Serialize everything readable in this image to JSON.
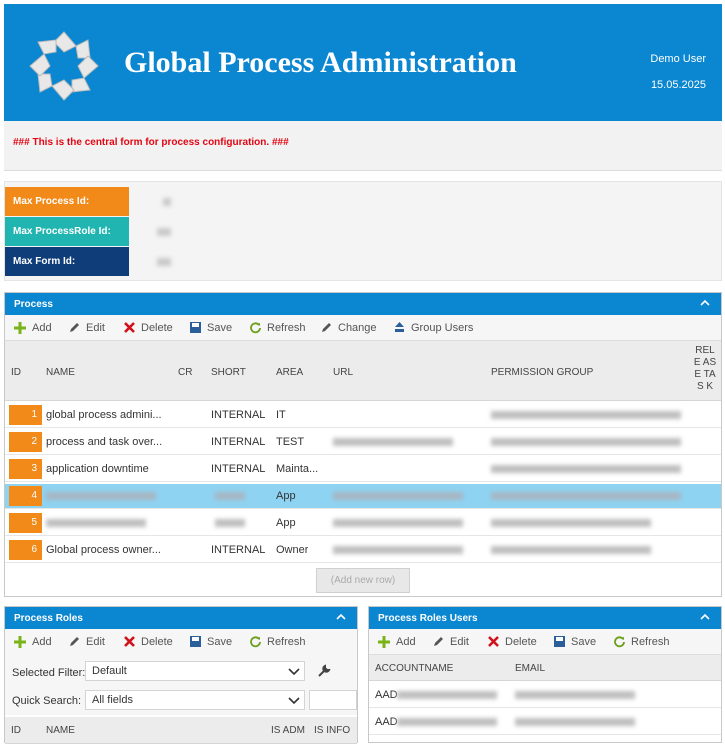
{
  "header": {
    "title": "Global Process Administration",
    "user": "Demo User",
    "date": "15.05.2025"
  },
  "banner": {
    "text": "### This is the central form for process configuration. ###"
  },
  "info": {
    "rows": [
      {
        "label": "Max Process Id:",
        "color": "#f28a1a"
      },
      {
        "label": "Max ProcessRole Id:",
        "color": "#20b5b0"
      },
      {
        "label": "Max Form Id:",
        "color": "#0f3d79"
      }
    ]
  },
  "process": {
    "title": "Process",
    "toolbar": [
      "Add",
      "Edit",
      "Delete",
      "Save",
      "Refresh",
      "Change",
      "Group Users"
    ],
    "columns": {
      "id": "ID",
      "name": "NAME",
      "cr": "CR",
      "short": "SHORT",
      "area": "AREA",
      "url": "URL",
      "perm": "PERMISSION GROUP",
      "release": "RELE ASE TAS K"
    },
    "rows": [
      {
        "id": "1",
        "name": "global process admini...",
        "short": "INTERNAL",
        "area": "IT"
      },
      {
        "id": "2",
        "name": "process and task over...",
        "short": "INTERNAL",
        "area": "TEST"
      },
      {
        "id": "3",
        "name": "application downtime",
        "short": "INTERNAL",
        "area": "Mainta..."
      },
      {
        "id": "4",
        "name": "",
        "short": "",
        "area": "App"
      },
      {
        "id": "5",
        "name": "",
        "short": "",
        "area": "App"
      },
      {
        "id": "6",
        "name": "Global process owner...",
        "short": "INTERNAL",
        "area": "Owner"
      }
    ],
    "add_row": "(Add new row)"
  },
  "roles": {
    "title": "Process Roles",
    "toolbar": [
      "Add",
      "Edit",
      "Delete",
      "Save",
      "Refresh"
    ],
    "filter_label": "Selected Filter:",
    "filter_value": "Default",
    "search_label": "Quick Search:",
    "search_value": "All fields",
    "columns": {
      "id": "ID",
      "name": "NAME",
      "admin": "IS ADM",
      "info": "IS INFO"
    }
  },
  "role_users": {
    "title": "Process Roles Users",
    "toolbar": [
      "Add",
      "Edit",
      "Delete",
      "Save",
      "Refresh"
    ],
    "columns": {
      "account": "ACCOUNTNAME",
      "email": "EMAIL"
    },
    "rows": [
      {
        "account": "AAD"
      },
      {
        "account": "AAD"
      }
    ]
  }
}
